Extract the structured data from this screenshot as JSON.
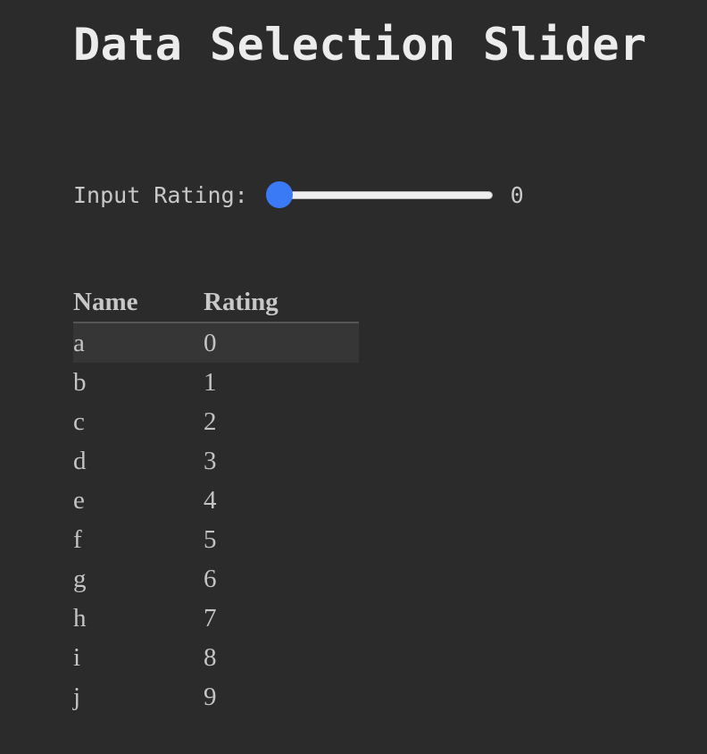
{
  "title": "Data Selection Slider",
  "slider": {
    "label": "Input Rating:",
    "value": 0,
    "min": 0,
    "max": 9,
    "thumb_color": "#3a7bf5"
  },
  "table": {
    "headers": [
      "Name",
      "Rating"
    ],
    "highlighted_row": 0,
    "rows": [
      {
        "name": "a",
        "rating": "0"
      },
      {
        "name": "b",
        "rating": "1"
      },
      {
        "name": "c",
        "rating": "2"
      },
      {
        "name": "d",
        "rating": "3"
      },
      {
        "name": "e",
        "rating": "4"
      },
      {
        "name": "f",
        "rating": "5"
      },
      {
        "name": "g",
        "rating": "6"
      },
      {
        "name": "h",
        "rating": "7"
      },
      {
        "name": "i",
        "rating": "8"
      },
      {
        "name": "j",
        "rating": "9"
      }
    ]
  }
}
